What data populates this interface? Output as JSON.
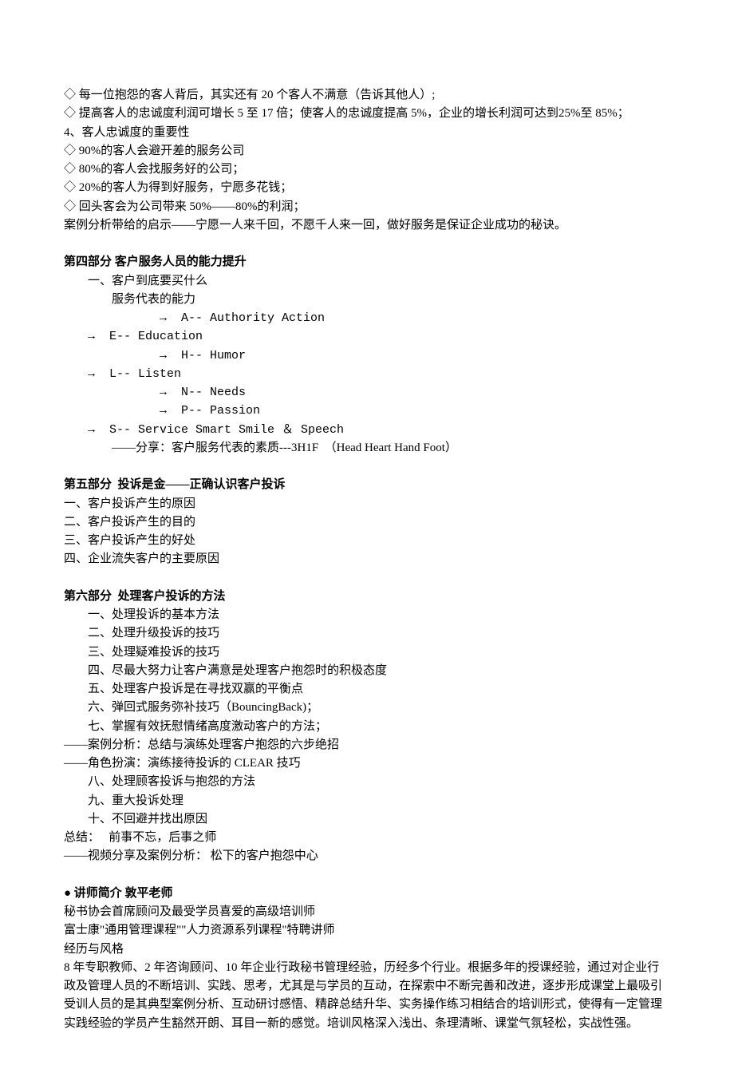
{
  "intro": [
    "◇ 每一位抱怨的客人背后，其实还有 20 个客人不满意（告诉其他人）;",
    "◇ 提高客人的忠诚度利润可增长 5 至 17 倍；使客人的忠诚度提高 5%，企业的增长利润可达到25%至 85%；",
    "4、客人忠诚度的重要性",
    "◇ 90%的客人会避开差的服务公司",
    "◇ 80%的客人会找服务好的公司；",
    "◇ 20%的客人为得到好服务，宁愿多花钱；",
    "◇ 回头客会为公司带来 50%——80%的利润；",
    "案例分析带给的启示——宁愿一人来千回，不愿千人来一回，做好服务是保证企业成功的秘诀。"
  ],
  "part4": {
    "title": "第四部分 客户服务人员的能力提升",
    "lines": [
      {
        "t": "一、客户到底要买什么",
        "i": 1
      },
      {
        "t": "服务代表的能力",
        "i": 2
      },
      {
        "t": "→  A-- Authority Action",
        "i": 3,
        "m": 1
      },
      {
        "t": "→  E-- Education",
        "i": 1,
        "m": 1
      },
      {
        "t": "→  H-- Humor",
        "i": 3,
        "m": 1
      },
      {
        "t": "→  L-- Listen",
        "i": 1,
        "m": 1
      },
      {
        "t": "→  N-- Needs",
        "i": 3,
        "m": 1
      },
      {
        "t": "→  P-- Passion",
        "i": 3,
        "m": 1
      },
      {
        "t": "→  S-- Service Smart Smile ＆ Speech",
        "i": 1,
        "m": 1
      },
      {
        "t": "——分享：客户服务代表的素质---3H1F  （Head Heart Hand Foot）",
        "i": 2
      }
    ]
  },
  "part5": {
    "title": "第五部分  投诉是金——正确认识客户投诉",
    "lines": [
      "一、客户投诉产生的原因",
      "二、客户投诉产生的目的",
      "三、客户投诉产生的好处",
      "四、企业流失客户的主要原因"
    ]
  },
  "part6": {
    "title": "第六部分  处理客户投诉的方法",
    "lines": [
      {
        "t": "一、处理投诉的基本方法",
        "i": 1
      },
      {
        "t": "二、处理升级投诉的技巧",
        "i": 1
      },
      {
        "t": "三、处理疑难投诉的技巧",
        "i": 1
      },
      {
        "t": "四、尽最大努力让客户满意是处理客户抱怨时的积极态度",
        "i": 1
      },
      {
        "t": "五、处理客户投诉是在寻找双赢的平衡点",
        "i": 1
      },
      {
        "t": "六、弹回式服务弥补技巧（BouncingBack)；",
        "i": 1
      },
      {
        "t": "七、掌握有效抚慰情绪高度激动客户的方法；",
        "i": 1
      },
      {
        "t": "——案例分析：总结与演练处理客户抱怨的六步绝招",
        "i": 0
      },
      {
        "t": "——角色扮演：演练接待投诉的 CLEAR 技巧",
        "i": 0
      },
      {
        "t": "八、处理顾客投诉与抱怨的方法",
        "i": 1
      },
      {
        "t": "九、重大投诉处理",
        "i": 1
      },
      {
        "t": "十、不回避并找出原因",
        "i": 1
      },
      {
        "t": "总结：   前事不忘，后事之师",
        "i": 0
      },
      {
        "t": "——视频分享及案例分析： 松下的客户抱怨中心",
        "i": 0
      }
    ]
  },
  "instructor": {
    "title": "● 讲师简介 敦平老师",
    "lines": [
      "秘书协会首席顾问及最受学员喜爱的高级培训师",
      "富士康\"通用管理课程\"\"人力资源系列课程\"特聘讲师",
      "经历与风格",
      "8 年专职教师、2 年咨询顾问、10 年企业行政秘书管理经验，历经多个行业。根据多年的授课经验，通过对企业行政及管理人员的不断培训、实践、思考，尤其是与学员的互动，在探索中不断完善和改进，逐步形成课堂上最吸引受训人员的是其典型案例分析、互动研讨感悟、精辟总结升华、实务操作练习相结合的培训形式，使得有一定管理实践经验的学员产生豁然开朗、耳目一新的感觉。培训风格深入浅出、条理清晰、课堂气氛轻松，实战性强。"
    ]
  }
}
